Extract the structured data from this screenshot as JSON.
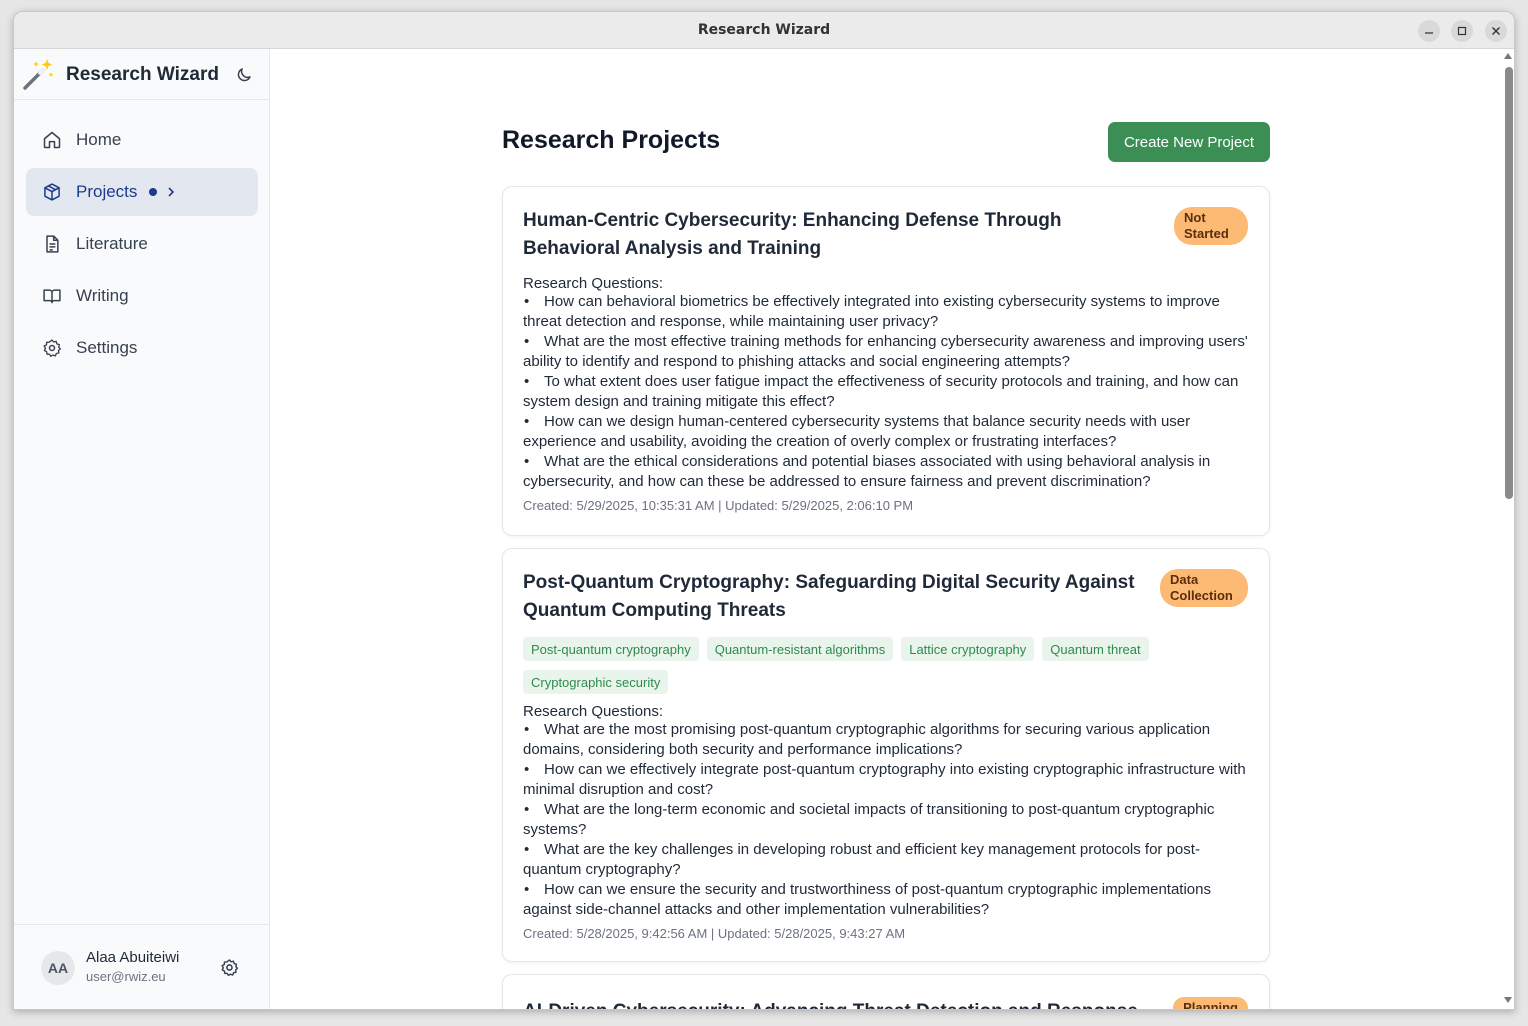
{
  "window": {
    "title": "Research Wizard"
  },
  "sidebar": {
    "brand": "Research Wizard",
    "items": [
      {
        "label": "Home",
        "icon": "home-icon"
      },
      {
        "label": "Projects",
        "icon": "cube-icon",
        "active": true
      },
      {
        "label": "Literature",
        "icon": "document-icon"
      },
      {
        "label": "Writing",
        "icon": "book-open-icon"
      },
      {
        "label": "Settings",
        "icon": "gear-icon"
      }
    ],
    "user": {
      "initials": "AA",
      "name": "Alaa Abuiteiwi",
      "email": "user@rwiz.eu"
    }
  },
  "main": {
    "title": "Research Projects",
    "create_label": "Create New Project",
    "projects": [
      {
        "title": "Human-Centric Cybersecurity: Enhancing Defense Through Behavioral Analysis and Training",
        "status": "Not Started",
        "status_color": "#fdba74",
        "tags": [],
        "rq_label": "Research Questions:",
        "questions": [
          "How can behavioral biometrics be effectively integrated into existing cybersecurity systems to improve threat detection and response, while maintaining user privacy?",
          "What are the most effective training methods for enhancing cybersecurity awareness and improving users' ability to identify and respond to phishing attacks and social engineering attempts?",
          "To what extent does user fatigue impact the effectiveness of security protocols and training, and how can system design and training mitigate this effect?",
          "How can we design human-centered cybersecurity systems that balance security needs with user experience and usability, avoiding the creation of overly complex or frustrating interfaces?",
          "What are the ethical considerations and potential biases associated with using behavioral analysis in cybersecurity, and how can these be addressed to ensure fairness and prevent discrimination?"
        ],
        "meta": "Created: 5/29/2025, 10:35:31 AM | Updated: 5/29/2025, 2:06:10 PM"
      },
      {
        "title": "Post-Quantum Cryptography: Safeguarding Digital Security Against Quantum Computing Threats",
        "status": "Data Collection",
        "status_color": "#fdba74",
        "tags": [
          "Post-quantum cryptography",
          "Quantum-resistant algorithms",
          "Lattice cryptography",
          "Quantum threat",
          "Cryptographic security"
        ],
        "rq_label": "Research Questions:",
        "questions": [
          "What are the most promising post-quantum cryptographic algorithms for securing various application domains, considering both security and performance implications?",
          "How can we effectively integrate post-quantum cryptography into existing cryptographic infrastructure with minimal disruption and cost?",
          "What are the long-term economic and societal impacts of transitioning to post-quantum cryptographic systems?",
          "What are the key challenges in developing robust and efficient key management protocols for post-quantum cryptography?",
          "How can we ensure the security and trustworthiness of post-quantum cryptographic implementations against side-channel attacks and other implementation vulnerabilities?"
        ],
        "meta": "Created: 5/28/2025, 9:42:56 AM | Updated: 5/28/2025, 9:43:27 AM"
      },
      {
        "title": "AI-Driven Cybersecurity: Advancing Threat Detection and Response",
        "status": "Planning",
        "status_color": "#fdba74",
        "tags": [],
        "rq_label": "",
        "questions": [],
        "meta": ""
      }
    ]
  }
}
